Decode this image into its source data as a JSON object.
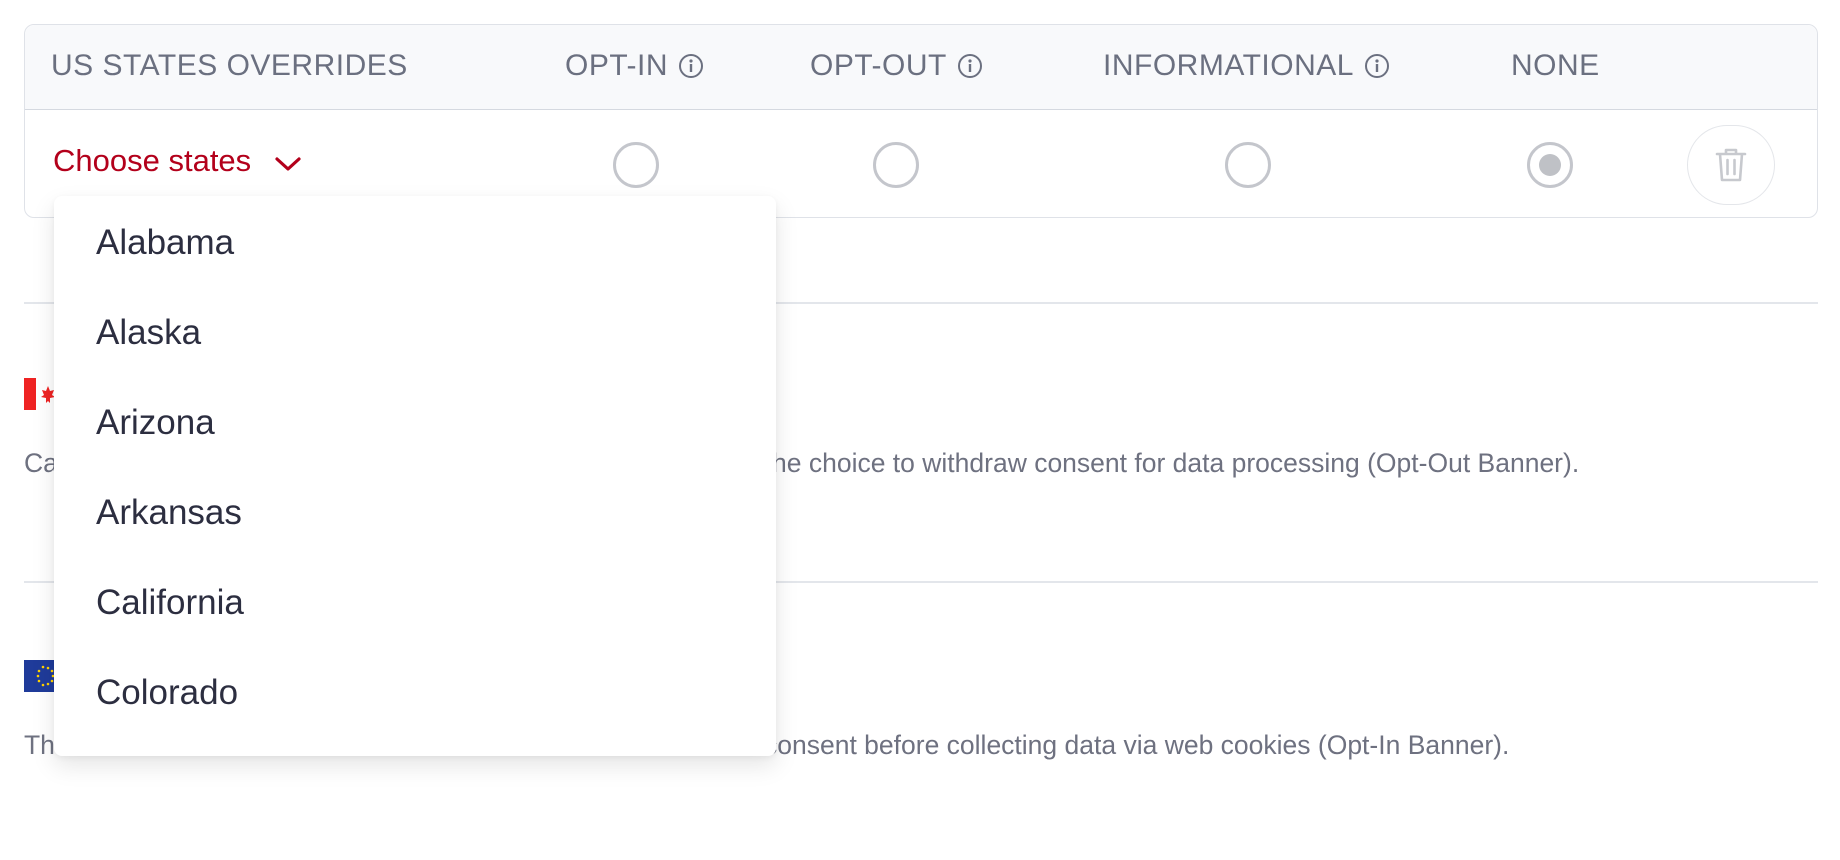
{
  "table": {
    "headers": {
      "states": "US STATES OVERRIDES",
      "opt_in": "OPT-IN",
      "opt_out": "OPT-OUT",
      "informational": "INFORMATIONAL",
      "none": "NONE"
    },
    "row": {
      "choose_label": "Choose states",
      "selected": "none"
    }
  },
  "dropdown": {
    "options": [
      "Alabama",
      "Alaska",
      "Arizona",
      "Arkansas",
      "California",
      "Colorado"
    ]
  },
  "sections": [
    {
      "flag": "canada-flag",
      "description_left": "Ca",
      "description_right": "he choice to withdraw consent for data processing (Opt-Out Banner)."
    },
    {
      "flag": "eu-flag",
      "description_left": "Th",
      "description_right": "consent before collecting data via web cookies (Opt-In Banner)."
    }
  ],
  "colors": {
    "accent": "#b3001b",
    "header_text": "#6b7080",
    "border": "#dfe2e8"
  }
}
